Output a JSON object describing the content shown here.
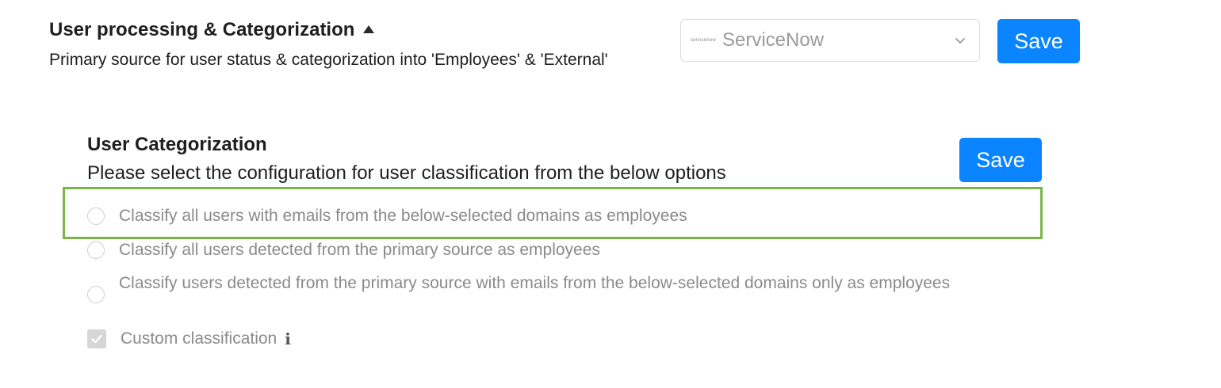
{
  "section": {
    "title": "User processing & Categorization",
    "description": "Primary source for user status & categorization into 'Employees' & 'External'",
    "toggle_icon": "caret-up-icon"
  },
  "source_select": {
    "logo_text": "servicenow",
    "value": "ServiceNow",
    "icon": "chevron-down-icon"
  },
  "buttons": {
    "save_top": "Save",
    "save_categorization": "Save"
  },
  "categorization": {
    "title": "User Categorization",
    "description": "Please select the configuration for user classification from the below options",
    "options": [
      {
        "label": "Classify all users with emails from the below-selected domains as employees",
        "type": "radio",
        "checked": false
      },
      {
        "label": "Classify all users detected from the primary source as employees",
        "type": "radio",
        "checked": false
      },
      {
        "label": "Classify users detected from the primary source with emails from the below-selected domains only as employees",
        "type": "radio",
        "checked": false
      },
      {
        "label": "Custom classification",
        "type": "checkbox",
        "checked": true,
        "icon": "info-icon"
      }
    ],
    "info_glyph": "i"
  },
  "colors": {
    "accent": "#0a84ff",
    "highlight_border": "#7ab648",
    "disabled_text": "#8a8a8a"
  }
}
